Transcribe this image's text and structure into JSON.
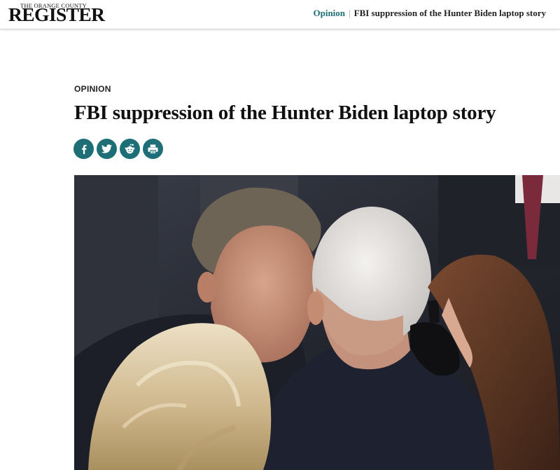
{
  "header": {
    "logo_top": "THE ORANGE COUNTY",
    "logo_main": "REGISTER",
    "breadcrumb": {
      "section": "Opinion",
      "separator": "|",
      "title": "FBI suppression of the Hunter Biden laptop story"
    }
  },
  "article": {
    "kicker": "OPINION",
    "headline": "FBI suppression of the Hunter Biden laptop story",
    "share_buttons": [
      {
        "icon": "facebook-icon"
      },
      {
        "icon": "twitter-icon"
      },
      {
        "icon": "reddit-icon"
      },
      {
        "icon": "print-icon"
      }
    ],
    "share_color": "#1d6e77"
  }
}
